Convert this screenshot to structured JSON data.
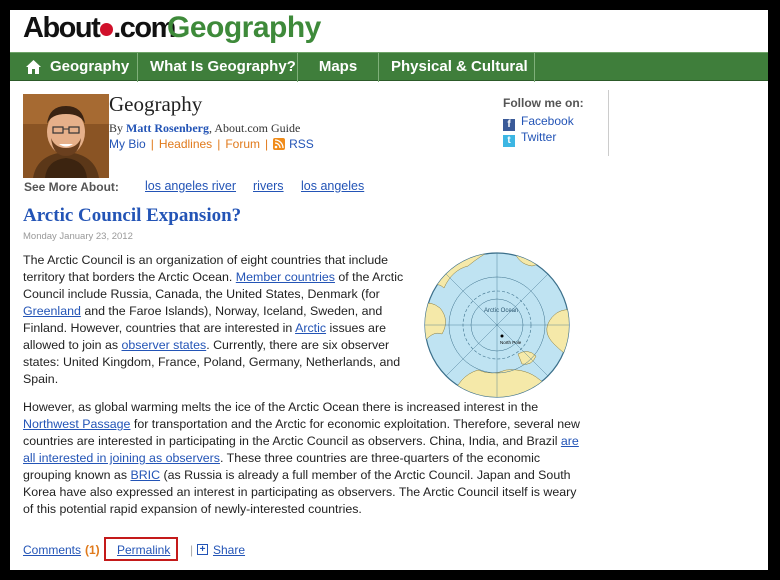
{
  "logo": {
    "brand": "About",
    "tld": ".com",
    "section": "Geography"
  },
  "nav": {
    "items": [
      {
        "label": "Geography"
      },
      {
        "label": "What Is Geography?"
      },
      {
        "label": "Maps"
      },
      {
        "label": "Physical & Cultural"
      }
    ]
  },
  "guide": {
    "title": "Geography",
    "by_prefix": "By ",
    "name": "Matt Rosenberg",
    "by_suffix": ", About.com Guide",
    "links": {
      "bio": "My Bio",
      "headlines": "Headlines",
      "forum": "Forum",
      "rss": "RSS"
    }
  },
  "follow": {
    "label": "Follow me on:",
    "facebook": "Facebook",
    "twitter": "Twitter"
  },
  "see_more": {
    "label": "See More About:",
    "tags": [
      "los angeles river",
      "rivers",
      "los angeles"
    ]
  },
  "article": {
    "title": "Arctic Council Expansion?",
    "date": "Monday January 23, 2012",
    "map_labels": {
      "ocean": "Arctic Ocean",
      "pole": "North Pole"
    },
    "p1": {
      "t1": "The Arctic Council is an organization of eight countries that include territory that borders the Arctic Ocean. ",
      "l1": "Member countries",
      "t2": " of the Arctic Council include Russia, Canada, the United States, Denmark (for ",
      "l2": "Greenland",
      "t3": " and the Faroe Islands), Norway, Iceland, Sweden, and Finland. However, countries that are interested in ",
      "l3": "Arctic",
      "t4": " issues are allowed to join as ",
      "l4": "observer states",
      "t5": ". Currently, there are six observer states: United Kingdom, France, Poland, Germany, Netherlands, and Spain."
    },
    "p2": {
      "t1": "However, as global warming melts the ice of the Arctic Ocean there is increased interest in the ",
      "l1": "Northwest Passage",
      "t2": " for transportation and the Arctic for economic exploitation. Therefore, several new countries are interested in participating in the Arctic Council as observers. China, India, and Brazil ",
      "l2": "are all interested in joining as observers",
      "t3": ". These three countries are three-quarters of the economic grouping known as ",
      "l3": "BRIC",
      "t4": " (as Russia is already a full member of the Arctic Council. Japan and South Korea have also expressed an interest in participating as observers. The Arctic Council itself is weary of this potential rapid expansion of newly-interested countries."
    }
  },
  "footer": {
    "comments": "Comments",
    "count": "(1)",
    "permalink": "Permalink",
    "pipe": "|",
    "share": "Share"
  },
  "colors": {
    "nav_green": "#3f7e3b",
    "logo_green": "#3e8a3a",
    "link_blue": "#2354b6",
    "accent_orange": "#e07a1c",
    "highlight_red": "#c41a1a"
  }
}
